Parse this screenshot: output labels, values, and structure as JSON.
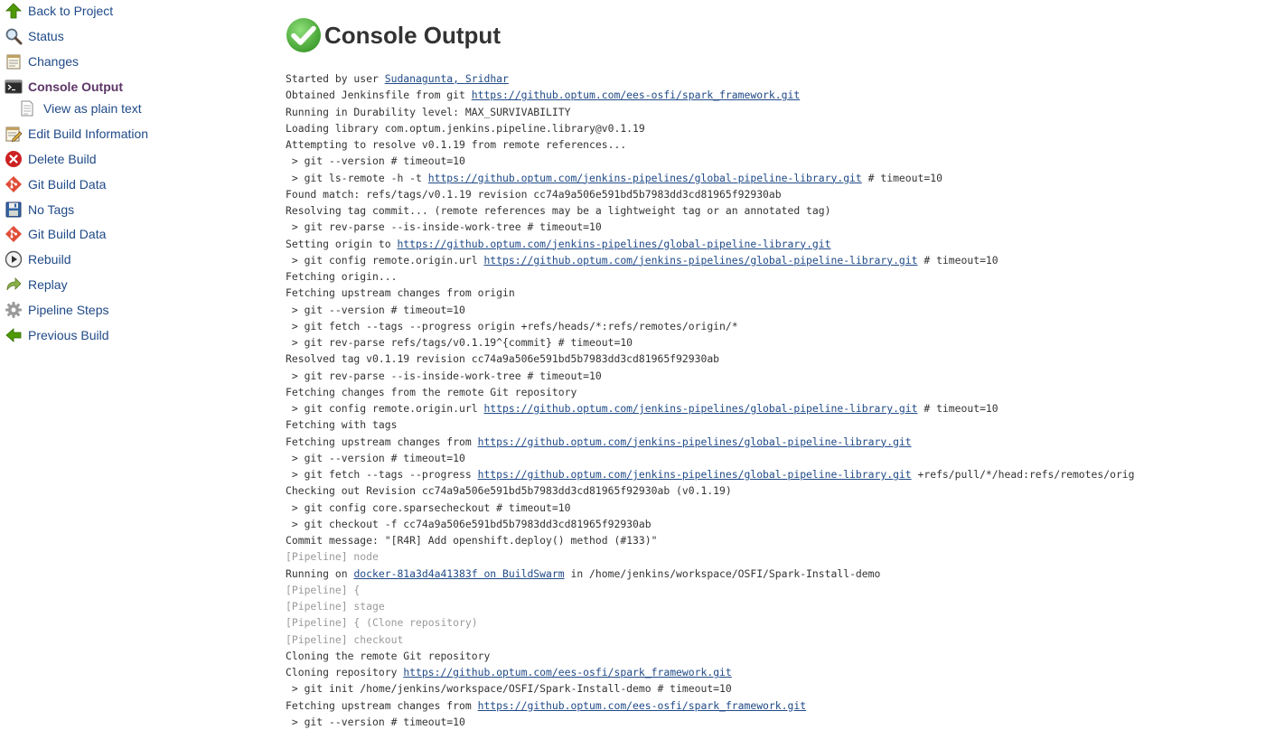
{
  "sidebar": {
    "items": [
      {
        "label": "Back to Project",
        "icon": "arrow-up-icon",
        "name": "sidebar-item-back-to-project",
        "top": 0
      },
      {
        "label": "Status",
        "icon": "magnifier-icon",
        "name": "sidebar-item-status"
      },
      {
        "label": "Changes",
        "icon": "notepad-icon",
        "name": "sidebar-item-changes"
      },
      {
        "label": "Console Output",
        "icon": "terminal-icon",
        "name": "sidebar-item-console-output",
        "active": true
      },
      {
        "label": "View as plain text",
        "icon": "document-icon",
        "name": "sidebar-item-view-as-plain-text",
        "sub": true
      },
      {
        "label": "Edit Build Information",
        "icon": "notepad-pencil-icon",
        "name": "sidebar-item-edit-build-information"
      },
      {
        "label": "Delete Build",
        "icon": "red-x-icon",
        "name": "sidebar-item-delete-build"
      },
      {
        "label": "Git Build Data",
        "icon": "git-icon",
        "name": "sidebar-item-git-build-data"
      },
      {
        "label": "No Tags",
        "icon": "floppy-disk-icon",
        "name": "sidebar-item-no-tags"
      },
      {
        "label": "Git Build Data",
        "icon": "git-icon",
        "name": "sidebar-item-git-build-data-2"
      },
      {
        "label": "Rebuild",
        "icon": "play-circle-icon",
        "name": "sidebar-item-rebuild"
      },
      {
        "label": "Replay",
        "icon": "replay-arrow-icon",
        "name": "sidebar-item-replay"
      },
      {
        "label": "Pipeline Steps",
        "icon": "gear-icon",
        "name": "sidebar-item-pipeline-steps"
      },
      {
        "label": "Previous Build",
        "icon": "arrow-left-icon",
        "name": "sidebar-item-previous-build"
      }
    ]
  },
  "header": {
    "title": "Console Output",
    "status_icon": "success-check-icon"
  },
  "colors": {
    "link": "#204a87",
    "active": "#5c3566",
    "pipeline_text": "#9a9a9a",
    "success": "#5cb85c"
  },
  "console": {
    "lines": [
      {
        "parts": [
          {
            "t": "Started by user "
          },
          {
            "t": "Sudanagunta, Sridhar",
            "link": true
          }
        ]
      },
      {
        "parts": [
          {
            "t": "Obtained Jenkinsfile from git "
          },
          {
            "t": "https://github.optum.com/ees-osfi/spark_framework.git",
            "link": true
          }
        ]
      },
      {
        "parts": [
          {
            "t": "Running in Durability level: MAX_SURVIVABILITY"
          }
        ]
      },
      {
        "parts": [
          {
            "t": "Loading library com.optum.jenkins.pipeline.library@v0.1.19"
          }
        ]
      },
      {
        "parts": [
          {
            "t": "Attempting to resolve v0.1.19 from remote references..."
          }
        ]
      },
      {
        "parts": [
          {
            "t": " > git --version # timeout=10"
          }
        ]
      },
      {
        "parts": [
          {
            "t": " > git ls-remote -h -t "
          },
          {
            "t": "https://github.optum.com/jenkins-pipelines/global-pipeline-library.git",
            "link": true
          },
          {
            "t": " # timeout=10"
          }
        ]
      },
      {
        "parts": [
          {
            "t": "Found match: refs/tags/v0.1.19 revision cc74a9a506e591bd5b7983dd3cd81965f92930ab"
          }
        ]
      },
      {
        "parts": [
          {
            "t": "Resolving tag commit... (remote references may be a lightweight tag or an annotated tag)"
          }
        ]
      },
      {
        "parts": [
          {
            "t": " > git rev-parse --is-inside-work-tree # timeout=10"
          }
        ]
      },
      {
        "parts": [
          {
            "t": "Setting origin to "
          },
          {
            "t": "https://github.optum.com/jenkins-pipelines/global-pipeline-library.git",
            "link": true
          }
        ]
      },
      {
        "parts": [
          {
            "t": " > git config remote.origin.url "
          },
          {
            "t": "https://github.optum.com/jenkins-pipelines/global-pipeline-library.git",
            "link": true
          },
          {
            "t": " # timeout=10"
          }
        ]
      },
      {
        "parts": [
          {
            "t": "Fetching origin..."
          }
        ]
      },
      {
        "parts": [
          {
            "t": "Fetching upstream changes from origin"
          }
        ]
      },
      {
        "parts": [
          {
            "t": " > git --version # timeout=10"
          }
        ]
      },
      {
        "parts": [
          {
            "t": " > git fetch --tags --progress origin +refs/heads/*:refs/remotes/origin/*"
          }
        ]
      },
      {
        "parts": [
          {
            "t": " > git rev-parse refs/tags/v0.1.19^{commit} # timeout=10"
          }
        ]
      },
      {
        "parts": [
          {
            "t": "Resolved tag v0.1.19 revision cc74a9a506e591bd5b7983dd3cd81965f92930ab"
          }
        ]
      },
      {
        "parts": [
          {
            "t": " > git rev-parse --is-inside-work-tree # timeout=10"
          }
        ]
      },
      {
        "parts": [
          {
            "t": "Fetching changes from the remote Git repository"
          }
        ]
      },
      {
        "parts": [
          {
            "t": " > git config remote.origin.url "
          },
          {
            "t": "https://github.optum.com/jenkins-pipelines/global-pipeline-library.git",
            "link": true
          },
          {
            "t": " # timeout=10"
          }
        ]
      },
      {
        "parts": [
          {
            "t": "Fetching with tags"
          }
        ]
      },
      {
        "parts": [
          {
            "t": "Fetching upstream changes from "
          },
          {
            "t": "https://github.optum.com/jenkins-pipelines/global-pipeline-library.git",
            "link": true
          }
        ]
      },
      {
        "parts": [
          {
            "t": " > git --version # timeout=10"
          }
        ]
      },
      {
        "parts": [
          {
            "t": " > git fetch --tags --progress "
          },
          {
            "t": "https://github.optum.com/jenkins-pipelines/global-pipeline-library.git",
            "link": true
          },
          {
            "t": " +refs/pull/*/head:refs/remotes/orig"
          }
        ]
      },
      {
        "parts": [
          {
            "t": "Checking out Revision cc74a9a506e591bd5b7983dd3cd81965f92930ab (v0.1.19)"
          }
        ]
      },
      {
        "parts": [
          {
            "t": " > git config core.sparsecheckout # timeout=10"
          }
        ]
      },
      {
        "parts": [
          {
            "t": " > git checkout -f cc74a9a506e591bd5b7983dd3cd81965f92930ab"
          }
        ]
      },
      {
        "parts": [
          {
            "t": "Commit message: \"[R4R] Add openshift.deploy() method (#133)\""
          }
        ]
      },
      {
        "pipeline": true,
        "parts": [
          {
            "t": "[Pipeline] node"
          }
        ]
      },
      {
        "parts": [
          {
            "t": "Running on "
          },
          {
            "t": "docker-81a3d4a41383f on BuildSwarm",
            "link": true
          },
          {
            "t": " in /home/jenkins/workspace/OSFI/Spark-Install-demo"
          }
        ]
      },
      {
        "pipeline": true,
        "parts": [
          {
            "t": "[Pipeline] {"
          }
        ]
      },
      {
        "pipeline": true,
        "parts": [
          {
            "t": "[Pipeline] stage"
          }
        ]
      },
      {
        "pipeline": true,
        "parts": [
          {
            "t": "[Pipeline] { (Clone repository)"
          }
        ]
      },
      {
        "pipeline": true,
        "parts": [
          {
            "t": "[Pipeline] checkout"
          }
        ]
      },
      {
        "parts": [
          {
            "t": "Cloning the remote Git repository"
          }
        ]
      },
      {
        "parts": [
          {
            "t": "Cloning repository "
          },
          {
            "t": "https://github.optum.com/ees-osfi/spark_framework.git",
            "link": true
          }
        ]
      },
      {
        "parts": [
          {
            "t": " > git init /home/jenkins/workspace/OSFI/Spark-Install-demo # timeout=10"
          }
        ]
      },
      {
        "parts": [
          {
            "t": "Fetching upstream changes from "
          },
          {
            "t": "https://github.optum.com/ees-osfi/spark_framework.git",
            "link": true
          }
        ]
      },
      {
        "parts": [
          {
            "t": " > git --version # timeout=10"
          }
        ]
      }
    ]
  }
}
